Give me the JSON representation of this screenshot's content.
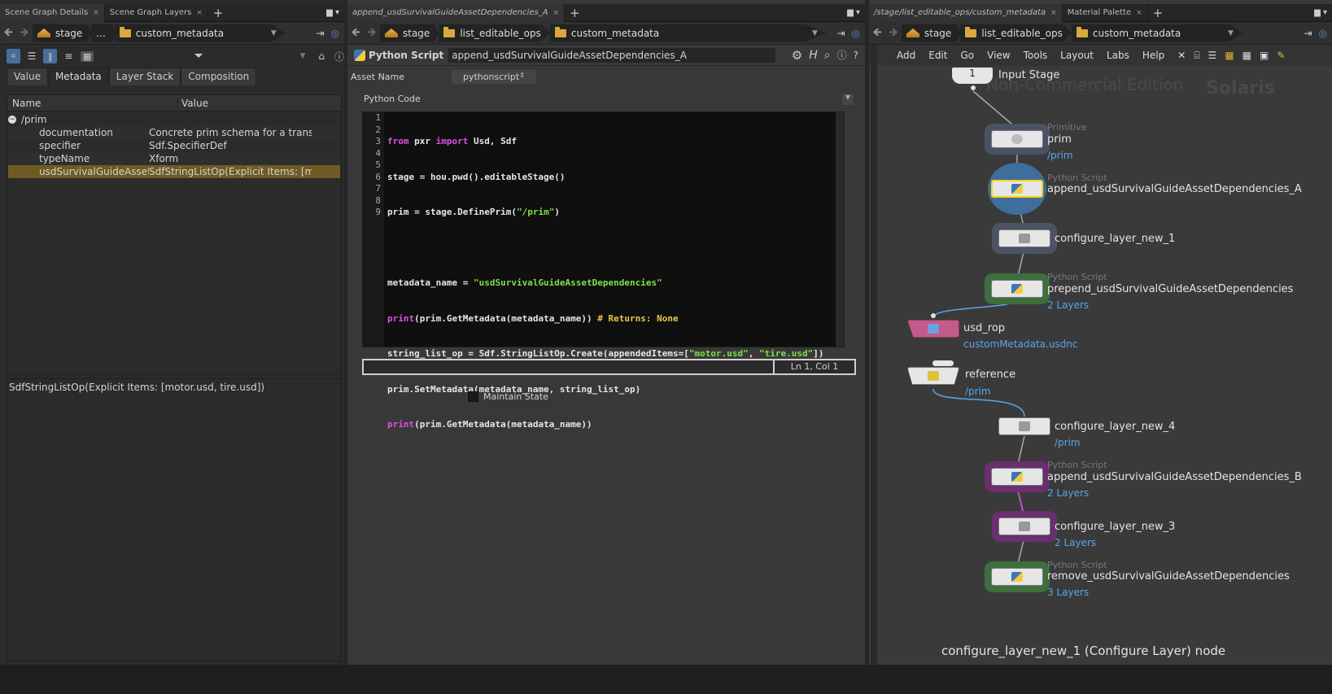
{
  "left_panel": {
    "tabs": [
      "Scene Graph Details",
      "Scene Graph Layers"
    ],
    "path": [
      "stage",
      "...",
      "custom_metadata"
    ],
    "subtabs": [
      "Value",
      "Metadata",
      "Layer Stack",
      "Composition"
    ],
    "columns": [
      "Name",
      "Value"
    ],
    "tree_root": "/prim",
    "rows": [
      {
        "name": "documentation",
        "value": "Concrete prim schema for a transf..."
      },
      {
        "name": "specifier",
        "value": "Sdf.SpecifierDef"
      },
      {
        "name": "typeName",
        "value": "Xform"
      },
      {
        "name": "usdSurvivalGuideAssetDepen...",
        "value": "SdfStringListOp(Explicit Items: [mo..."
      }
    ],
    "detail_text": "SdfStringListOp(Explicit Items: [motor.usd, tire.usd])"
  },
  "middle_panel": {
    "tab": "append_usdSurvivalGuideAssetDependencies_A",
    "path": [
      "stage",
      "list_editable_ops",
      "custom_metadata"
    ],
    "node_type": "Python Script",
    "node_name": "append_usdSurvivalGuideAssetDependencies_A",
    "asset_name_label": "Asset Name",
    "asset_name_value": "pythonscript",
    "python_code_label": "Python Code",
    "line_numbers": [
      "1",
      "2",
      "3",
      "4",
      "5",
      "6",
      "7",
      "8",
      "9"
    ],
    "code": {
      "l1a": "from",
      "l1b": " pxr ",
      "l1c": "import",
      "l1d": " Usd, Sdf",
      "l2": "stage = hou.pwd().editableStage()",
      "l3a": "prim = stage.DefinePrim(",
      "l3b": "\"/prim\"",
      "l3c": ")",
      "l5a": "metadata_name = ",
      "l5b": "\"usdSurvivalGuideAssetDependencies\"",
      "l6a": "print",
      "l6b": "(prim.GetMetadata(metadata_name)) ",
      "l6c": "# Returns: None",
      "l7a": "string_list_op = Sdf.StringListOp.Create(appendedItems=[",
      "l7b": "\"motor.usd\"",
      "l7c": ", ",
      "l7d": "\"tire.usd\"",
      "l7e": "])",
      "l8": "prim.SetMetadata(metadata_name, string_list_op)",
      "l9a": "print",
      "l9b": "(prim.GetMetadata(metadata_name))"
    },
    "cursor_pos": "Ln 1, Col 1",
    "maintain_state": "Maintain State"
  },
  "right_panel": {
    "tabs": [
      "/stage/list_editable_ops/custom_metadata",
      "Material Palette"
    ],
    "path": [
      "stage",
      "list_editable_ops",
      "custom_metadata"
    ],
    "menu": [
      "Add",
      "Edit",
      "Go",
      "View",
      "Tools",
      "Layout",
      "Labs",
      "Help"
    ],
    "watermark_left": "Non-Commercial Edition",
    "watermark_right": "Solaris",
    "input_stage_num": "1",
    "input_stage_label": "Input Stage",
    "nodes": {
      "prim": {
        "type": "Primitive",
        "name": "prim",
        "sub": "/prim"
      },
      "appendA": {
        "type": "Python Script",
        "name": "append_usdSurvivalGuideAssetDependencies_A"
      },
      "cfg1": {
        "name": "configure_layer_new_1"
      },
      "prepend": {
        "type": "Python Script",
        "name": "prepend_usdSurvivalGuideAssetDependencies",
        "sub": "2 Layers"
      },
      "rop": {
        "name": "usd_rop",
        "sub": "customMetadata.usdnc"
      },
      "ref": {
        "name": "reference",
        "sub": "/prim"
      },
      "cfg4": {
        "name": "configure_layer_new_4",
        "sub": "/prim"
      },
      "appendB": {
        "type": "Python Script",
        "name": "append_usdSurvivalGuideAssetDependencies_B",
        "sub": "2 Layers"
      },
      "cfg3": {
        "name": "configure_layer_new_3",
        "sub": "2 Layers"
      },
      "remove": {
        "type": "Python Script",
        "name": "remove_usdSurvivalGuideAssetDependencies",
        "sub": "3 Layers"
      }
    },
    "status": "configure_layer_new_1 (Configure Layer) node"
  },
  "colors": {
    "green_halo": "#3e6e3e",
    "purple_halo": "#6a2f6e",
    "blue_halo": "#3d6e9e",
    "rop_pink": "#c25a8a",
    "selected": "#ffd400"
  }
}
